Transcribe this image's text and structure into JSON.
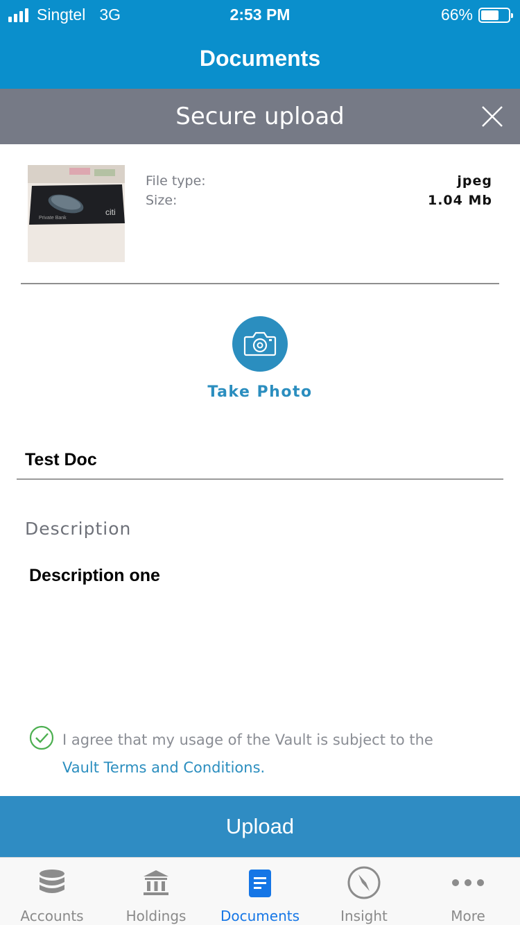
{
  "status_bar": {
    "carrier": "Singtel",
    "network": "3G",
    "time": "2:53 PM",
    "battery_percent": "66%",
    "battery_level": 0.66
  },
  "nav": {
    "title": "Documents"
  },
  "modal": {
    "title": "Secure upload",
    "close_icon": "close-icon"
  },
  "file": {
    "thumbnail_icon": "file-thumbnail",
    "type_label": "File type:",
    "type_value": "jpeg",
    "size_label": "Size:",
    "size_value": "1.04 Mb"
  },
  "camera": {
    "icon": "camera-icon",
    "label": "Take Photo"
  },
  "form": {
    "title_value": "Test Doc",
    "description_label": "Description",
    "description_value": "Description one"
  },
  "terms": {
    "checked": true,
    "text": "I agree that my usage of the Vault is subject to the",
    "link": "Vault Terms and Conditions."
  },
  "upload_label": "Upload",
  "colors": {
    "header_blue": "#0a8fcc",
    "modal_gray": "#767a86",
    "accent_blue": "#2b8ebf",
    "check_green": "#4caf50",
    "active_tab": "#1576e6"
  },
  "tabs": [
    {
      "label": "Accounts",
      "icon": "database-icon",
      "active": false
    },
    {
      "label": "Holdings",
      "icon": "bank-icon",
      "active": false
    },
    {
      "label": "Documents",
      "icon": "document-icon",
      "active": true
    },
    {
      "label": "Insight",
      "icon": "compass-icon",
      "active": false
    },
    {
      "label": "More",
      "icon": "more-dots-icon",
      "active": false
    }
  ]
}
